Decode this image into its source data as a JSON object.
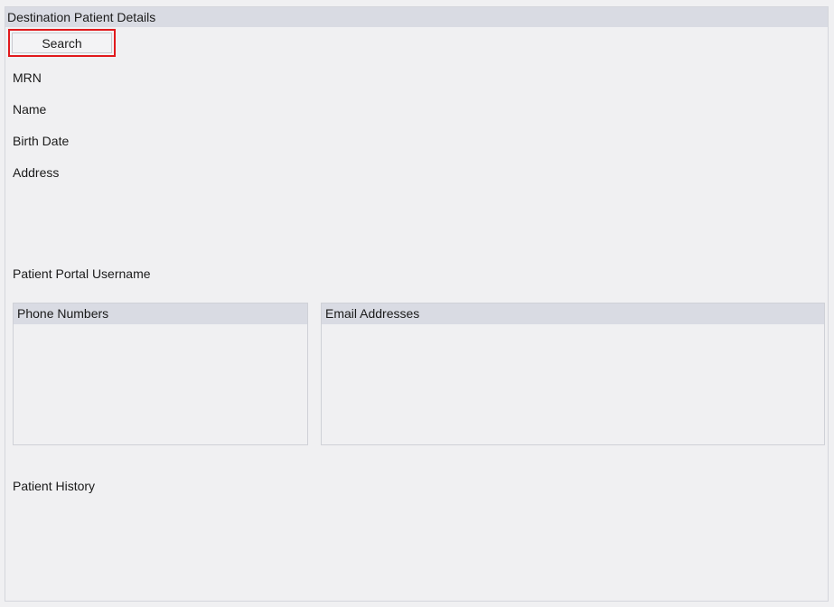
{
  "panel": {
    "title": "Destination Patient Details",
    "search_label": "Search"
  },
  "fields": {
    "mrn": "MRN",
    "name": "Name",
    "birth_date": "Birth Date",
    "address": "Address",
    "portal_username": "Patient Portal Username",
    "patient_history": "Patient History"
  },
  "lists": {
    "phone_numbers": "Phone Numbers",
    "email_addresses": "Email Addresses"
  },
  "colors": {
    "header_bg": "#d9dbe3",
    "page_bg": "#f0f0f2",
    "focus_outline": "#e1191c"
  }
}
